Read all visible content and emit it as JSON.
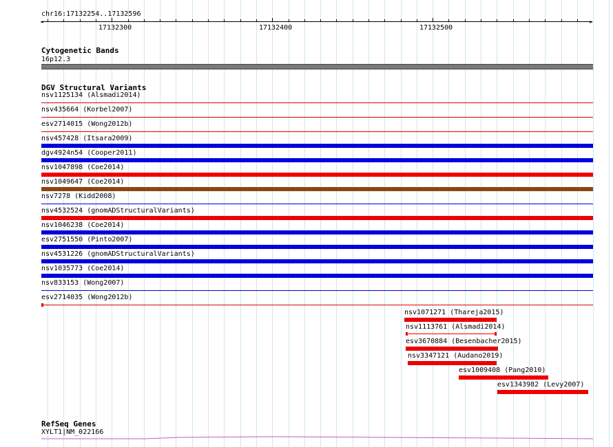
{
  "location": "chr16:17132254..17132596",
  "ruler": {
    "labels": [
      "17132300",
      "17132400",
      "17132500"
    ]
  },
  "cytoband_track": {
    "title": "Cytogenetic Bands",
    "band": "16p12.3"
  },
  "dgv_track": {
    "title": "DGV Structural Variants",
    "full_rows": [
      {
        "label": "nsv1125134 (Alsmadi2014)",
        "style": "thin",
        "color": "#e00000"
      },
      {
        "label": "nsv435664 (Korbel2007)",
        "style": "thin",
        "color": "#e00000"
      },
      {
        "label": "esv2714015 (Wong2012b)",
        "style": "thin",
        "color": "#e00000"
      },
      {
        "label": "nsv457428 (Itsara2009)",
        "style": "thick",
        "color": "#0000dd"
      },
      {
        "label": "dgv4924n54 (Cooper2011)",
        "style": "thick",
        "color": "#0000dd"
      },
      {
        "label": "nsv1047898 (Coe2014)",
        "style": "thick",
        "color": "#ee0000"
      },
      {
        "label": "nsv1049647 (Coe2014)",
        "style": "thick",
        "color": "#8b4513"
      },
      {
        "label": "nsv7278 (Kidd2008)",
        "style": "thin",
        "color": "#0000dd"
      },
      {
        "label": "nsv4532524 (gnomADStructuralVariants)",
        "style": "thick",
        "color": "#ee0000"
      },
      {
        "label": "nsv1046238 (Coe2014)",
        "style": "thick",
        "color": "#0000dd"
      },
      {
        "label": "esv2751550 (Pinto2007)",
        "style": "thick",
        "color": "#0000dd"
      },
      {
        "label": "nsv4531226 (gnomADStructuralVariants)",
        "style": "thick",
        "color": "#0000dd"
      },
      {
        "label": "nsv1035773 (Coe2014)",
        "style": "thick",
        "color": "#0000dd"
      },
      {
        "label": "nsv833153 (Wong2007)",
        "style": "thin",
        "color": "#0000dd"
      },
      {
        "label": "esv2714035 (Wong2012b)",
        "style": "thin-tick",
        "color": "#e00000"
      }
    ],
    "partial_rows": [
      {
        "label": "nsv1071271 (Thareja2015)",
        "style": "thick",
        "color": "#ee0000"
      },
      {
        "label": "nsv1113761 (Alsmadi2014)",
        "style": "thin-ends",
        "color": "#ee0000"
      },
      {
        "label": "esv3670884 (Besenbacher2015)",
        "style": "thick",
        "color": "#ee0000"
      },
      {
        "label": "nsv3347121 (Audano2019)",
        "style": "thick",
        "color": "#ee0000"
      },
      {
        "label": "esv1009408 (Pang2010)",
        "style": "thick",
        "color": "#ee0000"
      },
      {
        "label": "esv1343982 (Levy2007)",
        "style": "thick",
        "color": "#ee0000"
      }
    ]
  },
  "refseq_track": {
    "title": "RefSeq Genes",
    "gene": "XYLT1|NM_022166",
    "color": "#cc55cc"
  }
}
